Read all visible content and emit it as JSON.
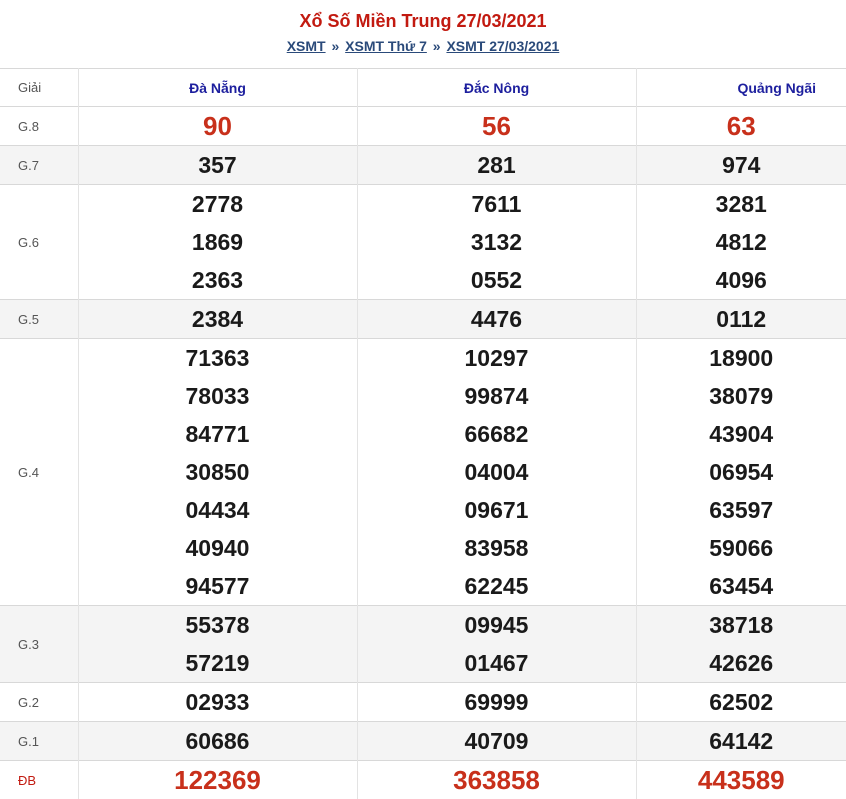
{
  "header": {
    "title": "Xổ Số Miền Trung 27/03/2021",
    "breadcrumb": [
      "XSMT",
      "XSMT Thứ 7",
      "XSMT 27/03/2021"
    ],
    "separator": "»"
  },
  "table": {
    "label_header": "Giải",
    "provinces": [
      "Đà Nẵng",
      "Đắc Nông",
      "Quảng Ngãi"
    ],
    "prizes": [
      {
        "label": "G.8",
        "results": [
          [
            "90"
          ],
          [
            "56"
          ],
          [
            "63"
          ]
        ]
      },
      {
        "label": "G.7",
        "results": [
          [
            "357"
          ],
          [
            "281"
          ],
          [
            "974"
          ]
        ]
      },
      {
        "label": "G.6",
        "results": [
          [
            "2778",
            "1869",
            "2363"
          ],
          [
            "7611",
            "3132",
            "0552"
          ],
          [
            "3281",
            "4812",
            "4096"
          ]
        ]
      },
      {
        "label": "G.5",
        "results": [
          [
            "2384"
          ],
          [
            "4476"
          ],
          [
            "0112"
          ]
        ]
      },
      {
        "label": "G.4",
        "results": [
          [
            "71363",
            "78033",
            "84771",
            "30850",
            "04434",
            "40940",
            "94577"
          ],
          [
            "10297",
            "99874",
            "66682",
            "04004",
            "09671",
            "83958",
            "62245"
          ],
          [
            "18900",
            "38079",
            "43904",
            "06954",
            "63597",
            "59066",
            "63454"
          ]
        ]
      },
      {
        "label": "G.3",
        "results": [
          [
            "55378",
            "57219"
          ],
          [
            "09945",
            "01467"
          ],
          [
            "38718",
            "42626"
          ]
        ]
      },
      {
        "label": "G.2",
        "results": [
          [
            "02933"
          ],
          [
            "69999"
          ],
          [
            "62502"
          ]
        ]
      },
      {
        "label": "G.1",
        "results": [
          [
            "60686"
          ],
          [
            "40709"
          ],
          [
            "64142"
          ]
        ]
      },
      {
        "label": "ĐB",
        "results": [
          [
            "122369"
          ],
          [
            "363858"
          ],
          [
            "443589"
          ]
        ]
      }
    ]
  },
  "colors": {
    "title_red": "#c21a10",
    "province_blue": "#1d1f9e",
    "highlight_red": "#c8301b",
    "alt_row_bg": "#f4f4f4"
  }
}
